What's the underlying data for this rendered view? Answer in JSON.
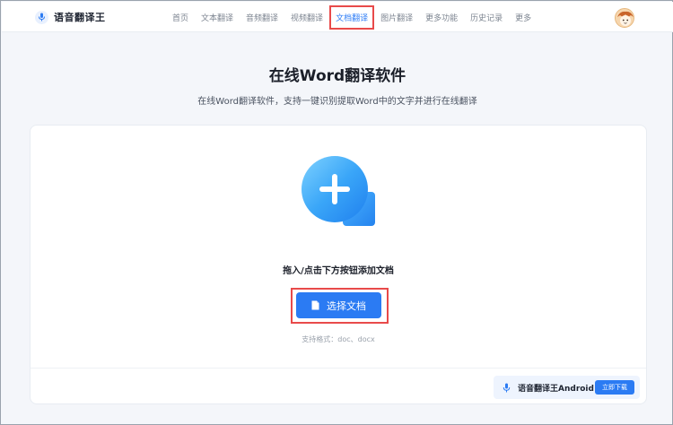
{
  "header": {
    "logo_text": "语音翻译王",
    "nav": [
      {
        "label": "首页"
      },
      {
        "label": "文本翻译"
      },
      {
        "label": "音频翻译"
      },
      {
        "label": "视频翻译"
      },
      {
        "label": "文档翻译"
      },
      {
        "label": "图片翻译"
      },
      {
        "label": "更多功能"
      },
      {
        "label": "历史记录"
      },
      {
        "label": "更多"
      }
    ],
    "active_nav": "文档翻译"
  },
  "main": {
    "title": "在线Word翻译软件",
    "subtitle": "在线Word翻译软件，支持一键识别提取Word中的文字并进行在线翻译",
    "drop_text": "拖入/点击下方按钮添加文档",
    "select_button": "选择文档",
    "formats": "支持格式：doc、docx"
  },
  "promo": {
    "app_name": "语音翻译王Android",
    "download_button": "立即下载"
  },
  "colors": {
    "accent": "#2b7bf3",
    "highlight_border": "#e84a4a"
  }
}
